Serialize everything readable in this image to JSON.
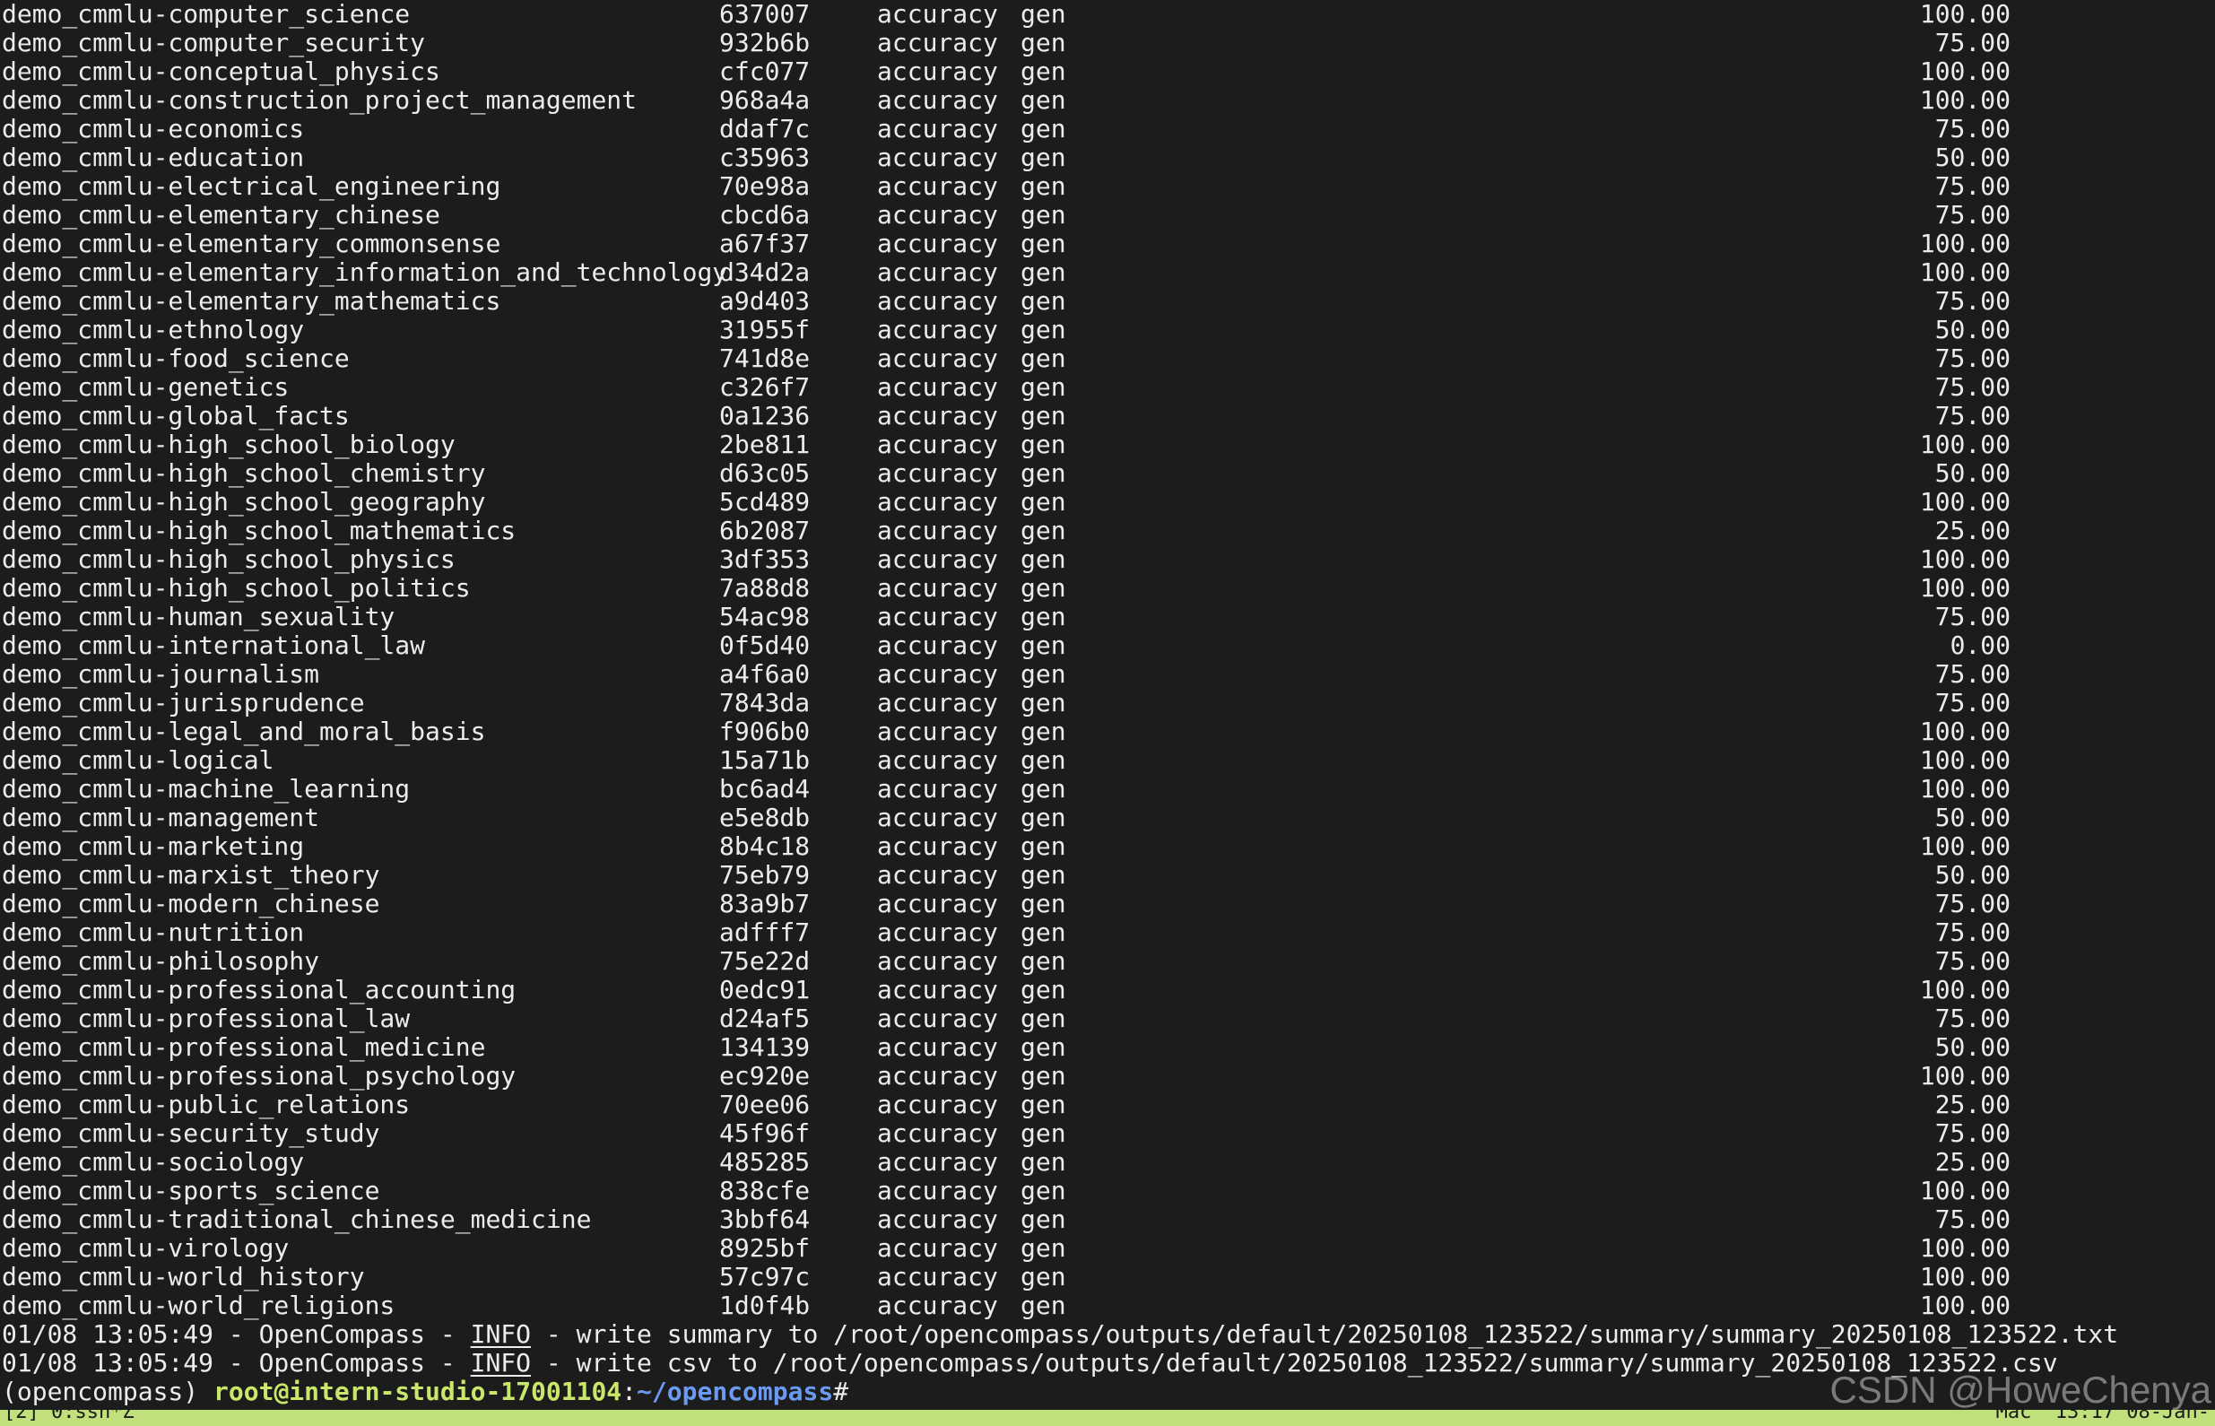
{
  "rows": [
    {
      "name": "demo_cmmlu-computer_science",
      "version": "637007",
      "metric": "accuracy",
      "mode": "gen",
      "score": "100.00"
    },
    {
      "name": "demo_cmmlu-computer_security",
      "version": "932b6b",
      "metric": "accuracy",
      "mode": "gen",
      "score": "75.00"
    },
    {
      "name": "demo_cmmlu-conceptual_physics",
      "version": "cfc077",
      "metric": "accuracy",
      "mode": "gen",
      "score": "100.00"
    },
    {
      "name": "demo_cmmlu-construction_project_management",
      "version": "968a4a",
      "metric": "accuracy",
      "mode": "gen",
      "score": "100.00"
    },
    {
      "name": "demo_cmmlu-economics",
      "version": "ddaf7c",
      "metric": "accuracy",
      "mode": "gen",
      "score": "75.00"
    },
    {
      "name": "demo_cmmlu-education",
      "version": "c35963",
      "metric": "accuracy",
      "mode": "gen",
      "score": "50.00"
    },
    {
      "name": "demo_cmmlu-electrical_engineering",
      "version": "70e98a",
      "metric": "accuracy",
      "mode": "gen",
      "score": "75.00"
    },
    {
      "name": "demo_cmmlu-elementary_chinese",
      "version": "cbcd6a",
      "metric": "accuracy",
      "mode": "gen",
      "score": "75.00"
    },
    {
      "name": "demo_cmmlu-elementary_commonsense",
      "version": "a67f37",
      "metric": "accuracy",
      "mode": "gen",
      "score": "100.00"
    },
    {
      "name": "demo_cmmlu-elementary_information_and_technology",
      "version": "d34d2a",
      "metric": "accuracy",
      "mode": "gen",
      "score": "100.00"
    },
    {
      "name": "demo_cmmlu-elementary_mathematics",
      "version": "a9d403",
      "metric": "accuracy",
      "mode": "gen",
      "score": "75.00"
    },
    {
      "name": "demo_cmmlu-ethnology",
      "version": "31955f",
      "metric": "accuracy",
      "mode": "gen",
      "score": "50.00"
    },
    {
      "name": "demo_cmmlu-food_science",
      "version": "741d8e",
      "metric": "accuracy",
      "mode": "gen",
      "score": "75.00"
    },
    {
      "name": "demo_cmmlu-genetics",
      "version": "c326f7",
      "metric": "accuracy",
      "mode": "gen",
      "score": "75.00"
    },
    {
      "name": "demo_cmmlu-global_facts",
      "version": "0a1236",
      "metric": "accuracy",
      "mode": "gen",
      "score": "75.00"
    },
    {
      "name": "demo_cmmlu-high_school_biology",
      "version": "2be811",
      "metric": "accuracy",
      "mode": "gen",
      "score": "100.00"
    },
    {
      "name": "demo_cmmlu-high_school_chemistry",
      "version": "d63c05",
      "metric": "accuracy",
      "mode": "gen",
      "score": "50.00"
    },
    {
      "name": "demo_cmmlu-high_school_geography",
      "version": "5cd489",
      "metric": "accuracy",
      "mode": "gen",
      "score": "100.00"
    },
    {
      "name": "demo_cmmlu-high_school_mathematics",
      "version": "6b2087",
      "metric": "accuracy",
      "mode": "gen",
      "score": "25.00"
    },
    {
      "name": "demo_cmmlu-high_school_physics",
      "version": "3df353",
      "metric": "accuracy",
      "mode": "gen",
      "score": "100.00"
    },
    {
      "name": "demo_cmmlu-high_school_politics",
      "version": "7a88d8",
      "metric": "accuracy",
      "mode": "gen",
      "score": "100.00"
    },
    {
      "name": "demo_cmmlu-human_sexuality",
      "version": "54ac98",
      "metric": "accuracy",
      "mode": "gen",
      "score": "75.00"
    },
    {
      "name": "demo_cmmlu-international_law",
      "version": "0f5d40",
      "metric": "accuracy",
      "mode": "gen",
      "score": "0.00"
    },
    {
      "name": "demo_cmmlu-journalism",
      "version": "a4f6a0",
      "metric": "accuracy",
      "mode": "gen",
      "score": "75.00"
    },
    {
      "name": "demo_cmmlu-jurisprudence",
      "version": "7843da",
      "metric": "accuracy",
      "mode": "gen",
      "score": "75.00"
    },
    {
      "name": "demo_cmmlu-legal_and_moral_basis",
      "version": "f906b0",
      "metric": "accuracy",
      "mode": "gen",
      "score": "100.00"
    },
    {
      "name": "demo_cmmlu-logical",
      "version": "15a71b",
      "metric": "accuracy",
      "mode": "gen",
      "score": "100.00"
    },
    {
      "name": "demo_cmmlu-machine_learning",
      "version": "bc6ad4",
      "metric": "accuracy",
      "mode": "gen",
      "score": "100.00"
    },
    {
      "name": "demo_cmmlu-management",
      "version": "e5e8db",
      "metric": "accuracy",
      "mode": "gen",
      "score": "50.00"
    },
    {
      "name": "demo_cmmlu-marketing",
      "version": "8b4c18",
      "metric": "accuracy",
      "mode": "gen",
      "score": "100.00"
    },
    {
      "name": "demo_cmmlu-marxist_theory",
      "version": "75eb79",
      "metric": "accuracy",
      "mode": "gen",
      "score": "50.00"
    },
    {
      "name": "demo_cmmlu-modern_chinese",
      "version": "83a9b7",
      "metric": "accuracy",
      "mode": "gen",
      "score": "75.00"
    },
    {
      "name": "demo_cmmlu-nutrition",
      "version": "adfff7",
      "metric": "accuracy",
      "mode": "gen",
      "score": "75.00"
    },
    {
      "name": "demo_cmmlu-philosophy",
      "version": "75e22d",
      "metric": "accuracy",
      "mode": "gen",
      "score": "75.00"
    },
    {
      "name": "demo_cmmlu-professional_accounting",
      "version": "0edc91",
      "metric": "accuracy",
      "mode": "gen",
      "score": "100.00"
    },
    {
      "name": "demo_cmmlu-professional_law",
      "version": "d24af5",
      "metric": "accuracy",
      "mode": "gen",
      "score": "75.00"
    },
    {
      "name": "demo_cmmlu-professional_medicine",
      "version": "134139",
      "metric": "accuracy",
      "mode": "gen",
      "score": "50.00"
    },
    {
      "name": "demo_cmmlu-professional_psychology",
      "version": "ec920e",
      "metric": "accuracy",
      "mode": "gen",
      "score": "100.00"
    },
    {
      "name": "demo_cmmlu-public_relations",
      "version": "70ee06",
      "metric": "accuracy",
      "mode": "gen",
      "score": "25.00"
    },
    {
      "name": "demo_cmmlu-security_study",
      "version": "45f96f",
      "metric": "accuracy",
      "mode": "gen",
      "score": "75.00"
    },
    {
      "name": "demo_cmmlu-sociology",
      "version": "485285",
      "metric": "accuracy",
      "mode": "gen",
      "score": "25.00"
    },
    {
      "name": "demo_cmmlu-sports_science",
      "version": "838cfe",
      "metric": "accuracy",
      "mode": "gen",
      "score": "100.00"
    },
    {
      "name": "demo_cmmlu-traditional_chinese_medicine",
      "version": "3bbf64",
      "metric": "accuracy",
      "mode": "gen",
      "score": "75.00"
    },
    {
      "name": "demo_cmmlu-virology",
      "version": "8925bf",
      "metric": "accuracy",
      "mode": "gen",
      "score": "100.00"
    },
    {
      "name": "demo_cmmlu-world_history",
      "version": "57c97c",
      "metric": "accuracy",
      "mode": "gen",
      "score": "100.00"
    },
    {
      "name": "demo_cmmlu-world_religions",
      "version": "1d0f4b",
      "metric": "accuracy",
      "mode": "gen",
      "score": "100.00"
    }
  ],
  "logs": [
    {
      "prefix": "01/08 13:05:49 - OpenCompass - ",
      "level": "INFO",
      "message": " - write summary to /root/opencompass/outputs/default/20250108_123522/summary/summary_20250108_123522.txt"
    },
    {
      "prefix": "01/08 13:05:49 - OpenCompass - ",
      "level": "INFO",
      "message": " - write csv to /root/opencompass/outputs/default/20250108_123522/summary/summary_20250108_123522.csv"
    }
  ],
  "prompt": {
    "env": "(opencompass) ",
    "user_host": "root@intern-studio-17001104",
    "sep": ":",
    "path": "~/opencompass",
    "symbol": "#"
  },
  "statusbar": {
    "left": "[2] 0:ssh*Z",
    "right": "\"Mac\" 13:17 08-Jan-"
  },
  "watermark": "CSDN @HoweChenya",
  "colors": {
    "background": "#1c1c1c",
    "foreground": "#ececec",
    "prompt_user": "#c9e86a",
    "prompt_path": "#6b9bf0",
    "statusbar": "#bfe07a"
  }
}
